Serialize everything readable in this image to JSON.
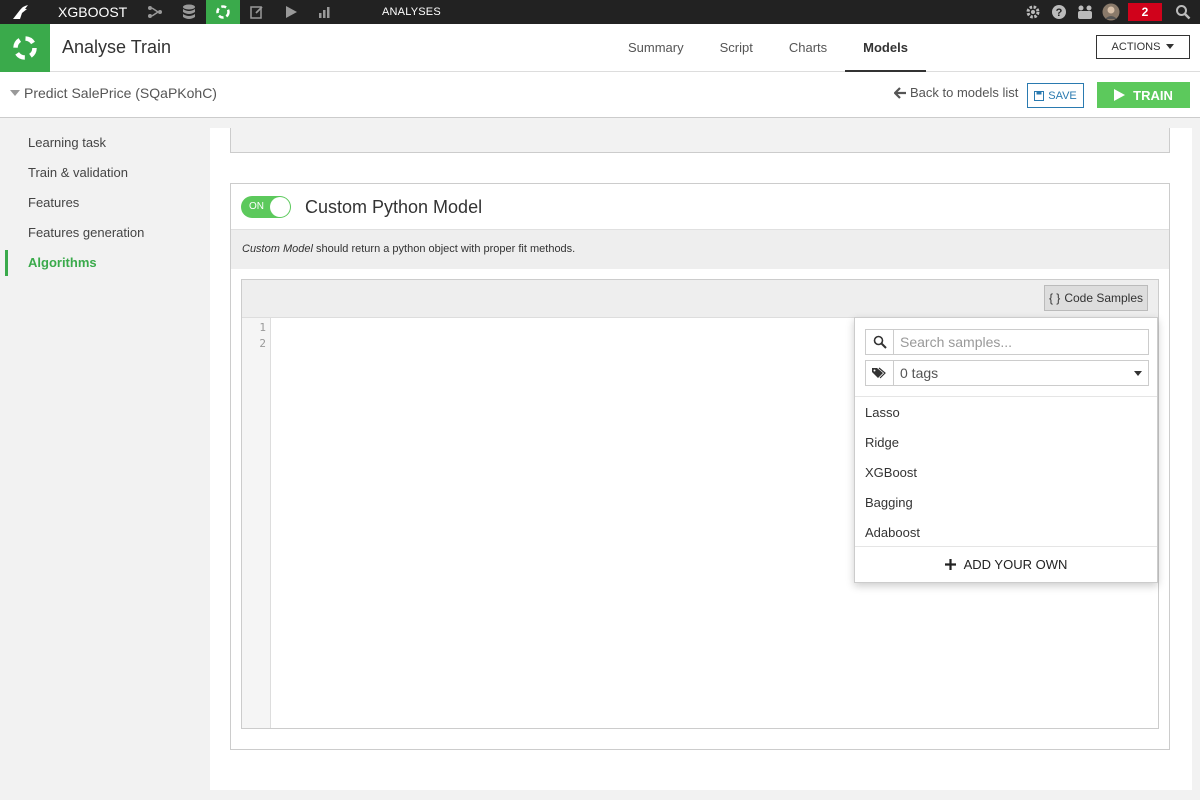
{
  "topbar": {
    "project_name": "XGBOOST",
    "section": "ANALYSES",
    "notification_count": "2",
    "nav_icons": [
      "flow-icon",
      "datasets-icon",
      "analyses-icon",
      "notebooks-icon",
      "jobs-icon",
      "dashboards-icon"
    ],
    "right_icons": [
      "gear-icon",
      "help-icon",
      "team-icon",
      "avatar",
      "search-icon"
    ]
  },
  "header": {
    "title": "Analyse Train",
    "tabs": [
      {
        "label": "Summary"
      },
      {
        "label": "Script"
      },
      {
        "label": "Charts"
      },
      {
        "label": "Models"
      }
    ],
    "active_tab": "Models",
    "actions_label": "ACTIONS"
  },
  "subheader": {
    "model_name": "Predict SalePrice (SQaPKohC)",
    "back_label": "Back to models list",
    "save_label": "SAVE",
    "train_label": "TRAIN"
  },
  "sidebar": {
    "items": [
      {
        "label": "Learning task"
      },
      {
        "label": "Train & validation"
      },
      {
        "label": "Features"
      },
      {
        "label": "Features generation"
      },
      {
        "label": "Algorithms"
      }
    ],
    "active": "Algorithms"
  },
  "algorithm": {
    "toggle_label": "ON",
    "title": "Custom Python Model",
    "desc_italic": "Custom Model",
    "desc_rest": " should return a python object with proper fit methods.",
    "code_samples_label": "Code Samples",
    "code_samples_brace": "{ }",
    "line_numbers": [
      "1",
      "2"
    ]
  },
  "samples_dropdown": {
    "search_placeholder": "Search samples...",
    "tags_value": "0 tags",
    "options": [
      "Lasso",
      "Ridge",
      "XGBoost",
      "Bagging",
      "Adaboost"
    ],
    "add_label": "ADD YOUR OWN"
  },
  "colors": {
    "accent_green": "#3aaa4b",
    "train_green": "#5cc95c",
    "save_blue": "#2a7ab0",
    "badge_red": "#d0021b"
  }
}
